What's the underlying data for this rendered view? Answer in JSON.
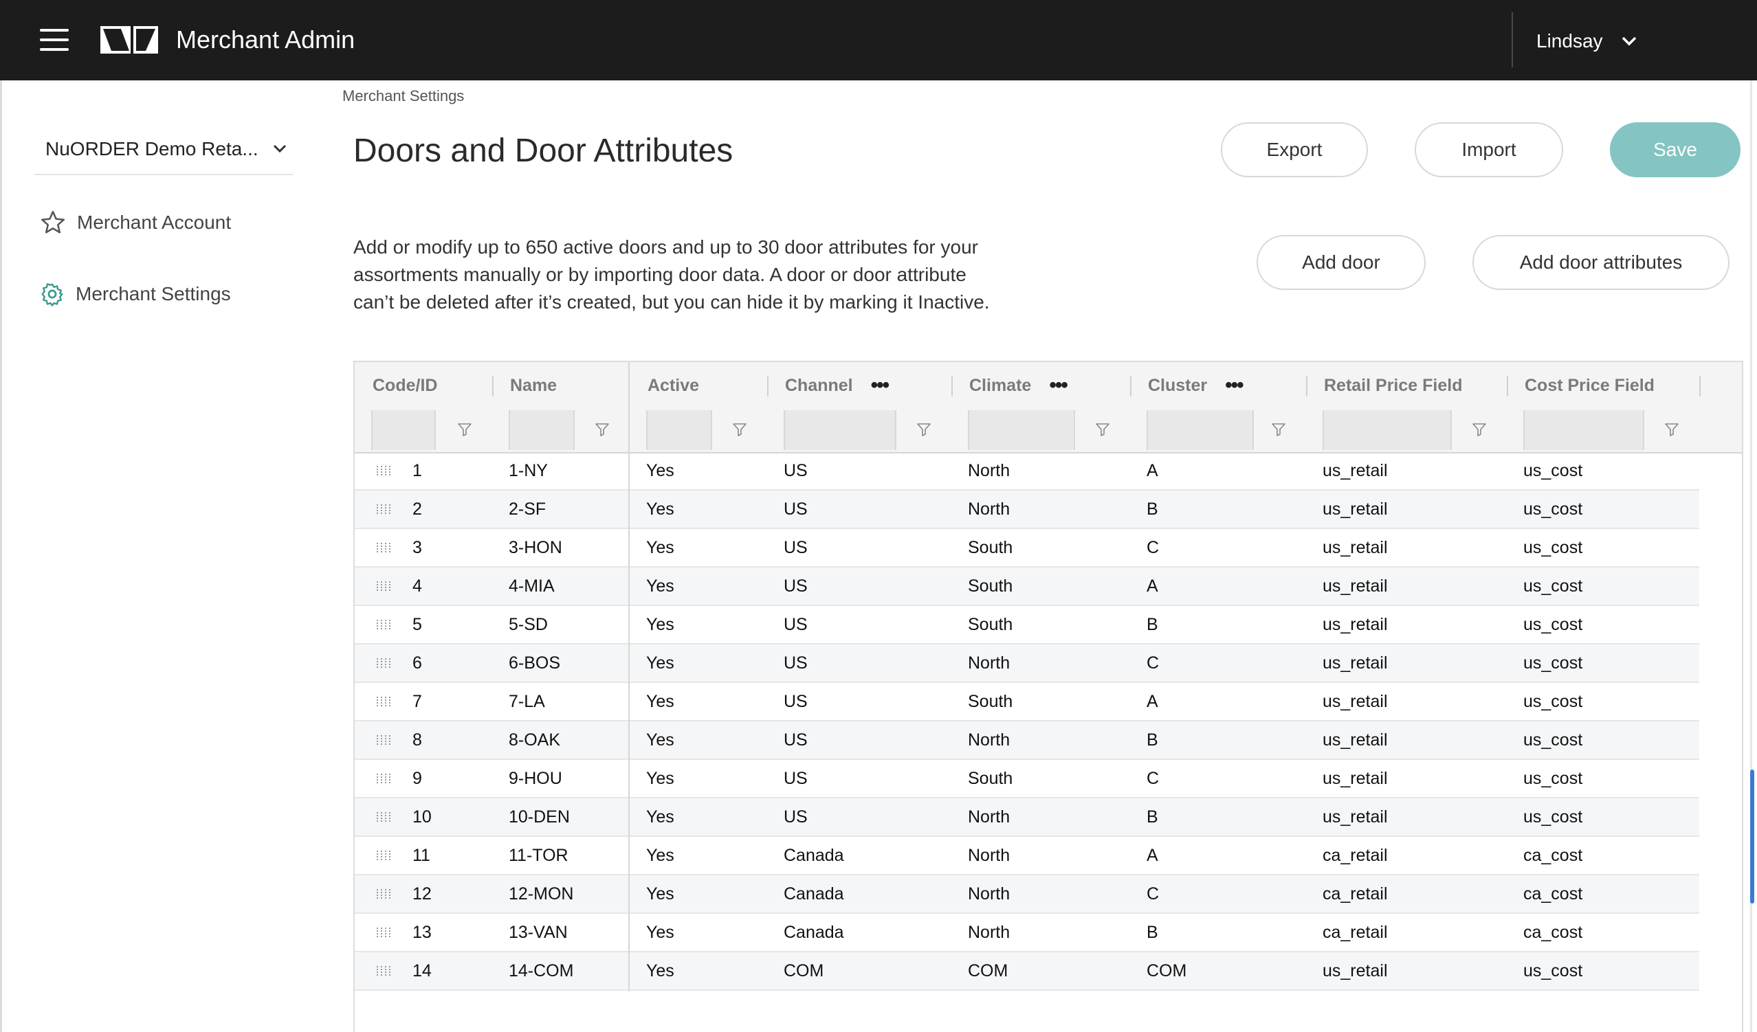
{
  "header": {
    "app_title": "Merchant Admin",
    "user_name": "Lindsay",
    "icons": {
      "menu": "hamburger-menu-icon",
      "logo": "nuorder-logo",
      "user_menu": "chevron-down-icon"
    }
  },
  "sidebar": {
    "merchant_name": "NuORDER Demo Reta...",
    "items": [
      {
        "label": "Merchant Account",
        "icon": "star-icon"
      },
      {
        "label": "Merchant Settings",
        "icon": "gear-icon"
      }
    ]
  },
  "breadcrumb": "Merchant Settings",
  "page": {
    "title": "Doors and Door Attributes",
    "description_lines": [
      "Add or modify up to 650 active doors and up to 30 door attributes for your",
      "assortments manually or by importing door data. A door or door attribute",
      "can’t be deleted after it’s created, but you can hide it by marking it Inactive."
    ]
  },
  "actions": {
    "export": "Export",
    "import": "Import",
    "save": "Save",
    "add_door": "Add door",
    "add_door_attributes": "Add door attributes"
  },
  "colors": {
    "topbar": "#1c1c1c",
    "save_button": "#84c4c2",
    "scrollbar": "#3b7bd0"
  },
  "table": {
    "columns": [
      "Code/ID",
      "Name",
      "Active",
      "Channel",
      "Climate",
      "Cluster",
      "Retail Price Field",
      "Cost Price Field"
    ],
    "rows": [
      [
        "1",
        "1-NY",
        "Yes",
        "US",
        "North",
        "A",
        "us_retail",
        "us_cost"
      ],
      [
        "2",
        "2-SF",
        "Yes",
        "US",
        "North",
        "B",
        "us_retail",
        "us_cost"
      ],
      [
        "3",
        "3-HON",
        "Yes",
        "US",
        "South",
        "C",
        "us_retail",
        "us_cost"
      ],
      [
        "4",
        "4-MIA",
        "Yes",
        "US",
        "South",
        "A",
        "us_retail",
        "us_cost"
      ],
      [
        "5",
        "5-SD",
        "Yes",
        "US",
        "South",
        "B",
        "us_retail",
        "us_cost"
      ],
      [
        "6",
        "6-BOS",
        "Yes",
        "US",
        "North",
        "C",
        "us_retail",
        "us_cost"
      ],
      [
        "7",
        "7-LA",
        "Yes",
        "US",
        "South",
        "A",
        "us_retail",
        "us_cost"
      ],
      [
        "8",
        "8-OAK",
        "Yes",
        "US",
        "North",
        "B",
        "us_retail",
        "us_cost"
      ],
      [
        "9",
        "9-HOU",
        "Yes",
        "US",
        "South",
        "C",
        "us_retail",
        "us_cost"
      ],
      [
        "10",
        "10-DEN",
        "Yes",
        "US",
        "North",
        "B",
        "us_retail",
        "us_cost"
      ],
      [
        "11",
        "11-TOR",
        "Yes",
        "Canada",
        "North",
        "A",
        "ca_retail",
        "ca_cost"
      ],
      [
        "12",
        "12-MON",
        "Yes",
        "Canada",
        "North",
        "C",
        "ca_retail",
        "ca_cost"
      ],
      [
        "13",
        "13-VAN",
        "Yes",
        "Canada",
        "North",
        "B",
        "ca_retail",
        "ca_cost"
      ],
      [
        "14",
        "14-COM",
        "Yes",
        "COM",
        "COM",
        "COM",
        "us_retail",
        "us_cost"
      ]
    ]
  }
}
